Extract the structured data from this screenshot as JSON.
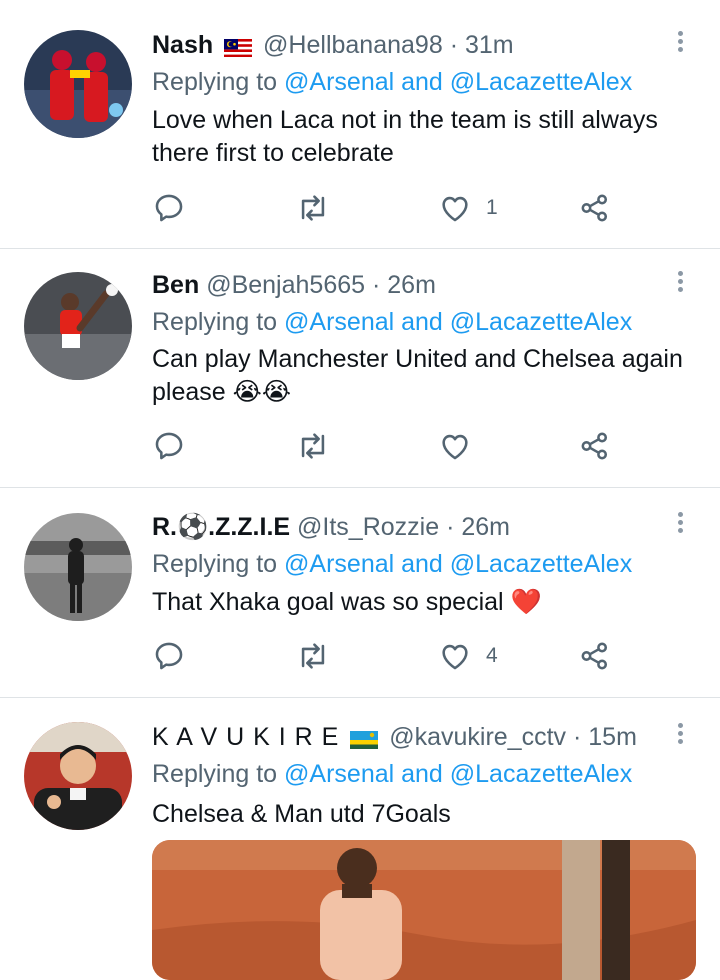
{
  "tweets": [
    {
      "name": "Nash",
      "flag": "malaysia-flag",
      "handle": "@Hellbanana98",
      "time": "· 31m",
      "reply_prefix": "Replying to",
      "reply_targets": "@Arsenal and @LacazetteAlex",
      "text": "Love when Laca not in the team is still always there first to celebrate",
      "likes": "1"
    },
    {
      "name": "Ben",
      "handle": "@Benjah5665",
      "time": "· 26m",
      "reply_prefix": "Replying to",
      "reply_targets": "@Arsenal and @LacazetteAlex",
      "text": "Can play Manchester United and Chelsea again please 😭😭",
      "likes": ""
    },
    {
      "name": "R.⚽.Z.Z.I.E",
      "handle": "@Its_Rozzie",
      "time": "· 26m",
      "reply_prefix": "Replying to",
      "reply_targets": "@Arsenal and @LacazetteAlex",
      "text": "That Xhaka goal was so special ❤️",
      "likes": "4"
    },
    {
      "name": "K A V U K I R E",
      "flag": "rwanda-flag",
      "handle": "@kavukire_cctv",
      "time": "· 15m",
      "reply_prefix": "Replying to",
      "reply_targets": "@Arsenal and @LacazetteAlex",
      "text": "Chelsea &  Man utd  7Goals"
    }
  ],
  "colors": {
    "link": "#1d9bf0",
    "secondary": "#536471",
    "separator": "#dfe3e6",
    "heart_emoji": "#e0245e"
  },
  "icons": [
    "reply-icon",
    "retweet-icon",
    "like-icon",
    "share-icon",
    "more-options-icon"
  ]
}
